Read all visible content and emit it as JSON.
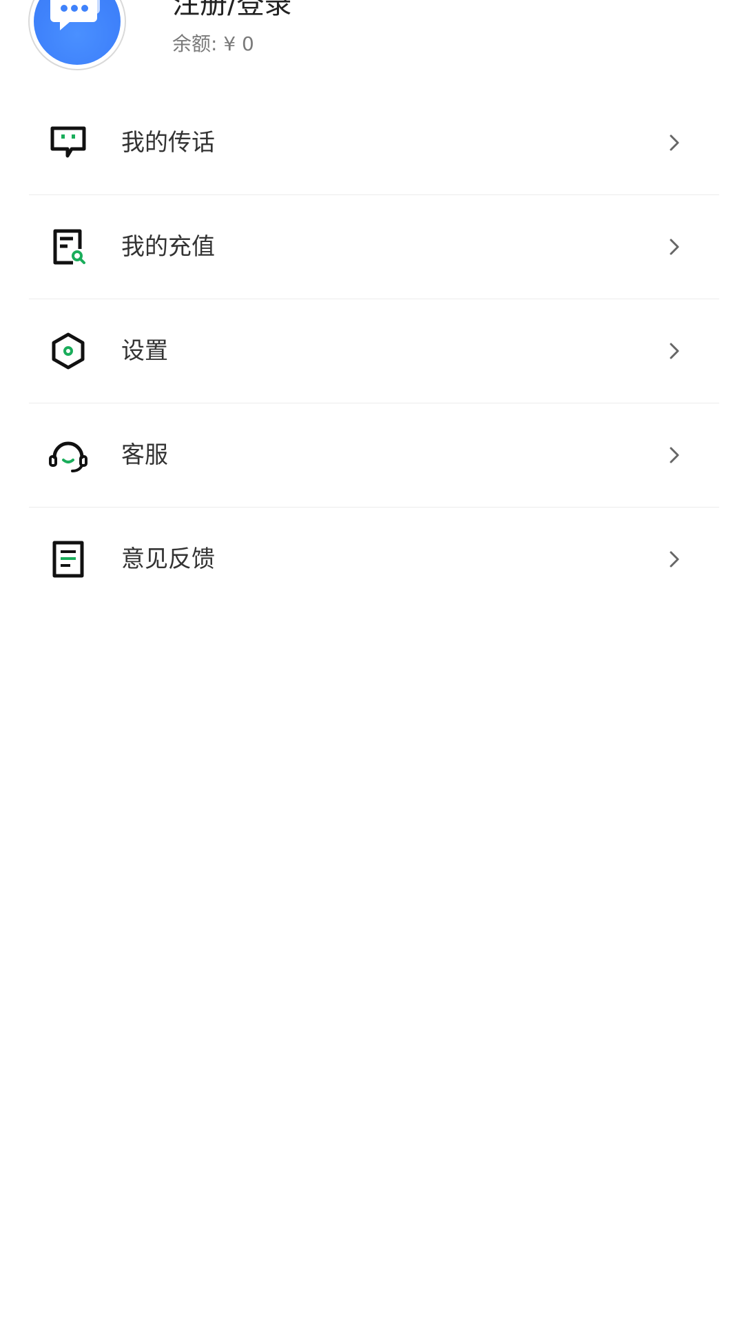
{
  "profile": {
    "title": "注册/登录",
    "balance": "余额: ¥ 0",
    "avatar_icon": "chat-bubble-icon",
    "avatar_color": "#3f82fb"
  },
  "menu": {
    "items": [
      {
        "label": "我的传话",
        "icon": "message-square-icon"
      },
      {
        "label": "我的充值",
        "icon": "receipt-search-icon"
      },
      {
        "label": "设置",
        "icon": "hexagon-settings-icon"
      },
      {
        "label": "客服",
        "icon": "headset-icon"
      },
      {
        "label": "意见反馈",
        "icon": "document-lines-icon"
      }
    ]
  },
  "colors": {
    "accent": "#1aad5b",
    "icon": "#111111",
    "label": "#333333",
    "divider": "#ececec",
    "chevron": "#666666"
  }
}
